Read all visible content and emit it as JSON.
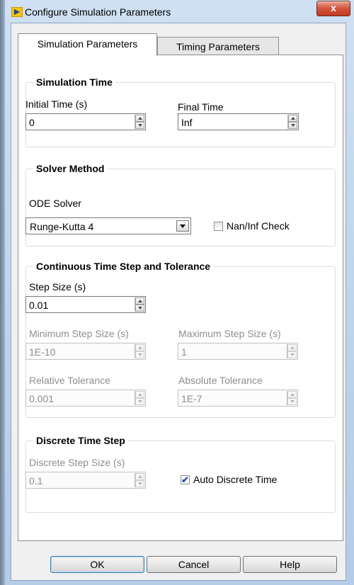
{
  "window": {
    "title": "Configure Simulation Parameters",
    "close_glyph": "x"
  },
  "tabs": [
    {
      "label": "Simulation Parameters",
      "selected": true
    },
    {
      "label": "Timing Parameters",
      "selected": false
    }
  ],
  "simulation_time": {
    "title": "Simulation Time",
    "initial_label": "Initial Time (s)",
    "initial_value": "0",
    "final_label": "Final Time",
    "final_value": "Inf"
  },
  "solver": {
    "title": "Solver Method",
    "ode_label": "ODE Solver",
    "ode_value": "Runge-Kutta 4",
    "naninf_label": "Nan/Inf Check",
    "naninf_checked": false
  },
  "continuous": {
    "title": "Continuous Time Step and Tolerance",
    "step_label": "Step Size (s)",
    "step_value": "0.01",
    "min_label": "Minimum Step Size (s)",
    "min_value": "1E-10",
    "max_label": "Maximum Step Size (s)",
    "max_value": "1",
    "rel_label": "Relative Tolerance",
    "rel_value": "0.001",
    "abs_label": "Absolute Tolerance",
    "abs_value": "1E-7"
  },
  "discrete": {
    "title": "Discrete Time Step",
    "step_label": "Discrete Step Size (s)",
    "step_value": "0.1",
    "auto_label": "Auto Discrete Time",
    "auto_checked": true,
    "check_glyph": "✔"
  },
  "buttons": {
    "ok": "OK",
    "cancel": "Cancel",
    "help": "Help"
  },
  "colors": {
    "frame": "#bcd3ea",
    "close": "#c23b22",
    "dialog": "#f0f0f0"
  }
}
